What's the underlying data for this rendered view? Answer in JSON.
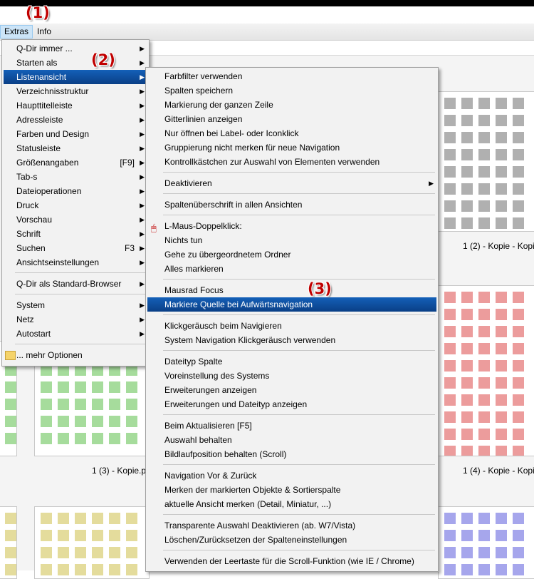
{
  "annotations": [
    "(1)",
    "(2)",
    "(3)"
  ],
  "menubar": {
    "extras": "Extras",
    "info": "Info"
  },
  "extras_menu": {
    "items": [
      {
        "label": "Q-Dir immer ...",
        "submenu": true
      },
      {
        "label": "Starten als",
        "submenu": true
      },
      {
        "label": "Listenansicht",
        "submenu": true,
        "highlighted": true
      },
      {
        "label": "Verzeichnisstruktur",
        "submenu": true
      },
      {
        "label": "Haupttitelleiste",
        "submenu": true
      },
      {
        "label": "Adressleiste",
        "submenu": true
      },
      {
        "label": "Farben und Design",
        "submenu": true
      },
      {
        "label": "Statusleiste",
        "submenu": true
      },
      {
        "label": "Größenangaben",
        "shortcut": "[F9]",
        "submenu": true
      },
      {
        "label": "Tab-s",
        "submenu": true
      },
      {
        "label": "Dateioperationen",
        "submenu": true
      },
      {
        "label": "Druck",
        "submenu": true
      },
      {
        "label": "Vorschau",
        "submenu": true
      },
      {
        "label": "Schrift",
        "submenu": true
      },
      {
        "label": "Suchen",
        "shortcut": "F3",
        "submenu": true
      },
      {
        "label": "Ansichtseinstellungen",
        "submenu": true
      },
      {
        "separator": true
      },
      {
        "label": "Q-Dir als Standard-Browser",
        "submenu": true
      },
      {
        "separator": true
      },
      {
        "label": "System",
        "submenu": true
      },
      {
        "label": "Netz",
        "submenu": true
      },
      {
        "label": "Autostart",
        "submenu": true
      },
      {
        "separator": true
      },
      {
        "label": "... mehr Optionen",
        "icon": "folder-icon"
      }
    ]
  },
  "listenansicht_menu": {
    "items": [
      {
        "label": "Farbfilter verwenden"
      },
      {
        "label": "Spalten speichern"
      },
      {
        "label": "Markierung der ganzen Zeile"
      },
      {
        "label": "Gitterlinien anzeigen"
      },
      {
        "label": "Nur öffnen bei Label- oder Iconklick"
      },
      {
        "label": "Gruppierung nicht merken für neue Navigation"
      },
      {
        "label": "Kontrollkästchen zur Auswahl von Elementen verwenden"
      },
      {
        "separator": true
      },
      {
        "label": "Deaktivieren",
        "submenu": true
      },
      {
        "separator": true
      },
      {
        "label": "Spaltenüberschrift in allen Ansichten"
      },
      {
        "separator": true
      },
      {
        "label": "L-Maus-Doppelklick:",
        "icon": "mouse-icon"
      },
      {
        "label": "Nichts tun"
      },
      {
        "label": "Gehe zu übergeordnetem Ordner"
      },
      {
        "label": "Alles markieren"
      },
      {
        "separator": true
      },
      {
        "label": "Mausrad Focus"
      },
      {
        "label": "Markiere Quelle bei Aufwärtsnavigation",
        "highlighted": true
      },
      {
        "separator": true
      },
      {
        "label": "Klickgeräusch beim Navigieren"
      },
      {
        "label": "System Navigation Klickgeräusch verwenden"
      },
      {
        "separator": true
      },
      {
        "label": "Dateityp Spalte"
      },
      {
        "label": "Voreinstellung des Systems"
      },
      {
        "label": "Erweiterungen anzeigen"
      },
      {
        "label": "Erweiterungen und Dateityp anzeigen"
      },
      {
        "separator": true
      },
      {
        "label": "Beim Aktualisieren [F5]"
      },
      {
        "label": "Auswahl behalten"
      },
      {
        "label": "Bildlaufposition behalten (Scroll)"
      },
      {
        "separator": true
      },
      {
        "label": "Navigation Vor & Zurück"
      },
      {
        "label": "Merken der markierten Objekte & Sortierspalte"
      },
      {
        "label": "aktuelle Ansicht merken (Detail, Miniatur, ...)"
      },
      {
        "separator": true
      },
      {
        "label": "Transparente Auswahl Deaktivieren (ab. W7/Vista)"
      },
      {
        "label": "Löschen/Zurücksetzen der Spalteneinstellungen"
      },
      {
        "separator": true
      },
      {
        "label": "Verwenden der Leertaste für die Scroll-Funktion (wie IE / Chrome)"
      }
    ]
  },
  "thumbnails": [
    {
      "caption": "1 (2) - Kopie - Kopi",
      "color": "#b0b0b0"
    },
    {
      "caption": "1 (3) - Kopie.p",
      "color": "#a6dc9c"
    },
    {
      "caption": "1 (4) - Kopie - Kopi",
      "color": "#ec9c9c"
    },
    {
      "caption": "",
      "color": "#e4dc9c"
    },
    {
      "caption": "",
      "color": "#a6a6ec"
    }
  ],
  "colors": {
    "highlight": "#0a3f86",
    "annotation": "#c00000",
    "menu_bg": "#f2f2f2"
  }
}
